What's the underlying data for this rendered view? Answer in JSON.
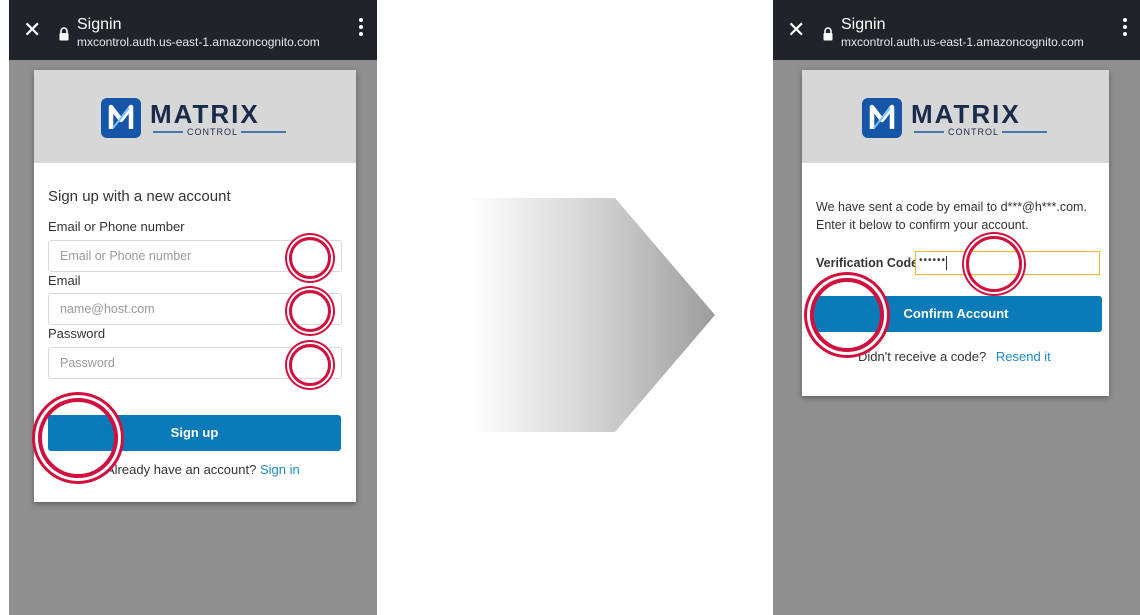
{
  "left_screen": {
    "title": "Signin",
    "url": "mxcontrol.auth.us-east-1.amazoncognito.com",
    "logo_name": "MATRIX",
    "logo_sub": "CONTROL",
    "heading": "Sign up with a new account",
    "field1_label": "Email or Phone number",
    "field1_placeholder": "Email or Phone number",
    "field2_label": "Email",
    "field2_placeholder": "name@host.com",
    "field3_label": "Password",
    "field3_placeholder": "Password",
    "button": "Sign up",
    "footer_text": "Already have an account?",
    "footer_link": "Sign in"
  },
  "right_screen": {
    "title": "Signin",
    "url": "mxcontrol.auth.us-east-1.amazoncognito.com",
    "logo_name": "MATRIX",
    "logo_sub": "CONTROL",
    "message_line1": "We have sent a code by email to d***@h***.com.",
    "message_line2": "Enter it below to confirm your account.",
    "code_label": "Verification Code",
    "code_value": "••••••",
    "button": "Confirm Account",
    "footer_text": "Didn't receive a code?",
    "footer_link": "Resend it"
  },
  "colors": {
    "accent_blue": "#0b7ab8",
    "highlight_ring": "#d1103e",
    "topbar": "#1e2429"
  },
  "icons": [
    "close-icon",
    "lock-icon",
    "more-vert-icon",
    "matrix-logo-icon",
    "arrow-right-icon"
  ]
}
